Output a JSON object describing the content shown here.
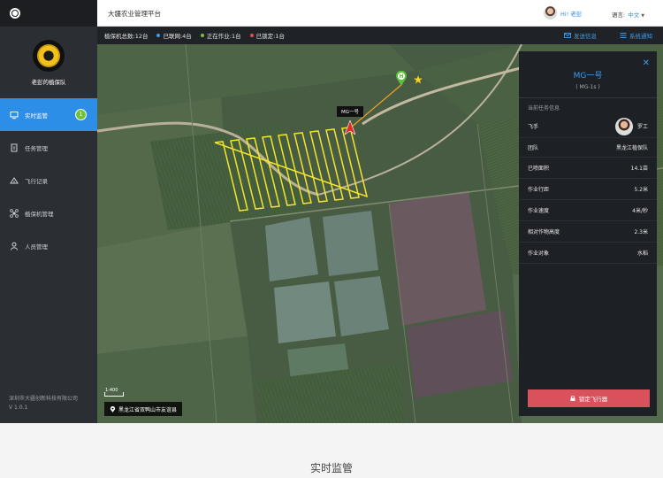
{
  "sidebar": {
    "team_name": "老彭的植保队",
    "items": [
      {
        "label": "实时监管",
        "icon": "monitor-icon",
        "active": true,
        "badge": "1"
      },
      {
        "label": "任务管理",
        "icon": "task-icon"
      },
      {
        "label": "飞行记录",
        "icon": "flight-record-icon"
      },
      {
        "label": "植保机管理",
        "icon": "drone-icon"
      },
      {
        "label": "人员管理",
        "icon": "people-icon"
      }
    ],
    "footer_company": "深圳市大疆创新科技有限公司",
    "footer_version": "V 1.0.1"
  },
  "header": {
    "title": "大疆农业管理平台",
    "user_name": "Hi! 老彭",
    "lang_label": "语言:",
    "lang_value": "中文"
  },
  "statusbar": {
    "total": "植保机总数:12台",
    "online": "已联网:4台",
    "working": "正在作业:1台",
    "locked": "已锁定:1台",
    "send_info": "发送信息",
    "notify": "系统通知",
    "colors": {
      "online": "#3d9cf0",
      "working": "#73c13a",
      "locked": "#e04a4a"
    }
  },
  "map": {
    "drone_label": "MG一号",
    "scale_label": "1:400",
    "location": "黑龙江省双鸭山市友谊县"
  },
  "panel": {
    "title": "MG一号",
    "subtitle": "( MG-1s )",
    "section_label": "当前任务信息",
    "pilot_label": "飞手",
    "pilot_value": "罗工",
    "team_label": "团队",
    "team_value": "黑龙江植保队",
    "rows": [
      {
        "label": "已喷面积",
        "value": "14.1亩"
      },
      {
        "label": "作业行距",
        "value": "5.2米"
      },
      {
        "label": "作业速度",
        "value": "4米/秒"
      },
      {
        "label": "相对作物高度",
        "value": "2.3米"
      },
      {
        "label": "作业对象",
        "value": "水稻"
      }
    ],
    "lock_button": "锁定飞行器"
  },
  "caption": "实时监管"
}
